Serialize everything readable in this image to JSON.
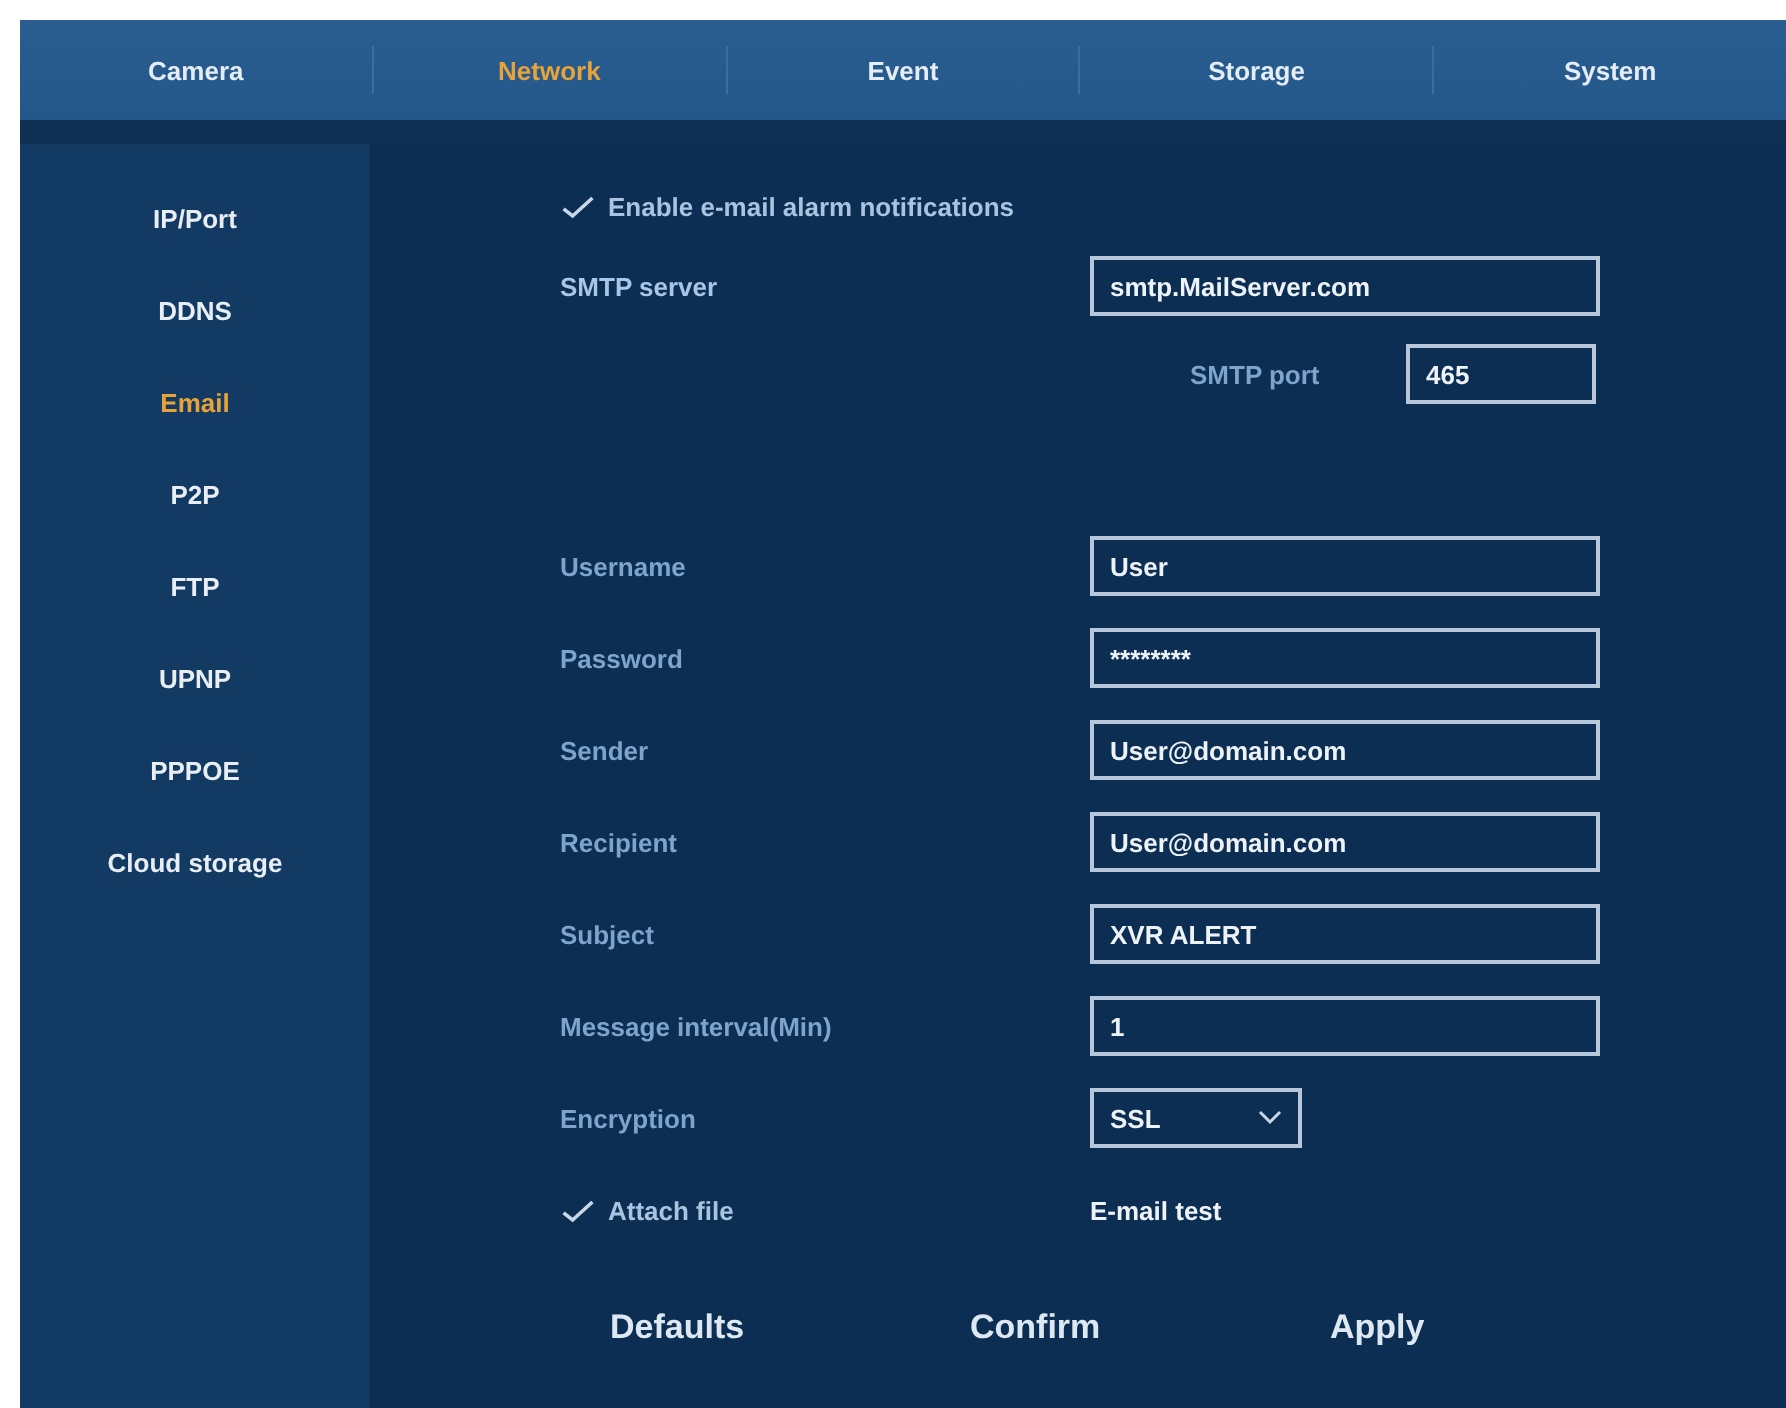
{
  "tabs": [
    {
      "label": "Camera",
      "selected": false
    },
    {
      "label": "Network",
      "selected": true
    },
    {
      "label": "Event",
      "selected": false
    },
    {
      "label": "Storage",
      "selected": false
    },
    {
      "label": "System",
      "selected": false
    }
  ],
  "sidebar": {
    "items": [
      {
        "label": "IP/Port",
        "selected": false
      },
      {
        "label": "DDNS",
        "selected": false
      },
      {
        "label": "Email",
        "selected": true
      },
      {
        "label": "P2P",
        "selected": false
      },
      {
        "label": "FTP",
        "selected": false
      },
      {
        "label": "UPNP",
        "selected": false
      },
      {
        "label": "PPPOE",
        "selected": false
      },
      {
        "label": "Cloud storage",
        "selected": false
      }
    ]
  },
  "enable_alarm": {
    "label": "Enable e-mail alarm notifications",
    "checked": true
  },
  "smtp_server": {
    "label": "SMTP server",
    "value": "smtp.MailServer.com"
  },
  "smtp_port": {
    "label": "SMTP port",
    "value": "465"
  },
  "fields": [
    {
      "kind": "text",
      "label": "Username",
      "value": "User"
    },
    {
      "kind": "text",
      "label": "Password",
      "value": "********"
    },
    {
      "kind": "text",
      "label": "Sender",
      "value": "User@domain.com"
    },
    {
      "kind": "text",
      "label": "Recipient",
      "value": "User@domain.com"
    },
    {
      "kind": "text",
      "label": "Subject",
      "value": "XVR ALERT"
    },
    {
      "kind": "text",
      "label": "Message interval(Min)",
      "value": "1"
    },
    {
      "kind": "select",
      "label": "Encryption",
      "value": "SSL"
    }
  ],
  "attach_file": {
    "label": "Attach file",
    "checked": true
  },
  "test_button": "E-mail test",
  "buttons": [
    "Defaults",
    "Confirm",
    "Apply"
  ]
}
